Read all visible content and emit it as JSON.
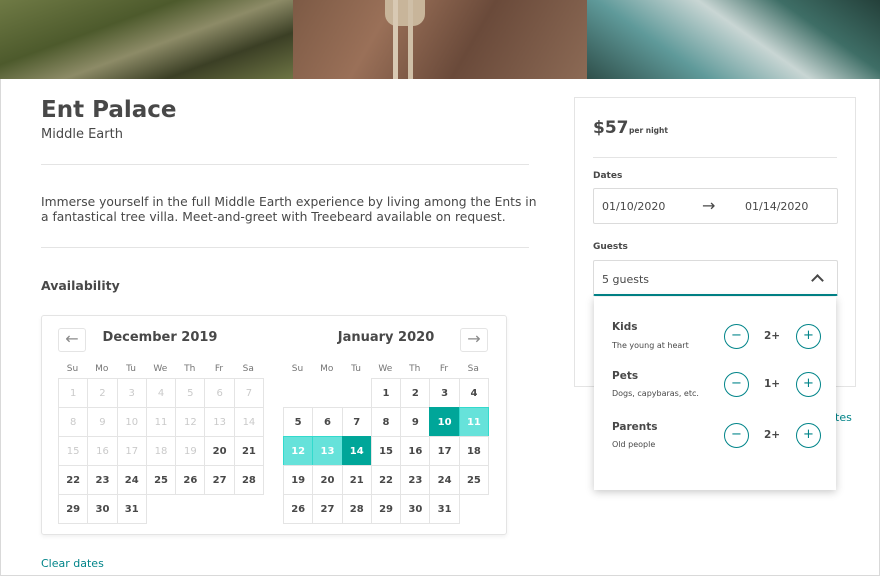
{
  "listing": {
    "title": "Ent Palace",
    "location": "Middle Earth",
    "description": "Immerse yourself in the full Middle Earth experience by living among the Ents in a fantastical tree villa. Meet-and-greet with Treebeard available on request.",
    "availability_label": "Availability"
  },
  "calendar": {
    "prev_icon": "arrow-left-icon",
    "next_icon": "arrow-right-icon",
    "weekdays": [
      "Su",
      "Mo",
      "Tu",
      "We",
      "Th",
      "Fr",
      "Sa"
    ],
    "months": [
      {
        "title": "December 2019",
        "offset": 0,
        "days": 31,
        "past_until": 19,
        "selected": [],
        "span": []
      },
      {
        "title": "January 2020",
        "offset": 3,
        "days": 31,
        "past_until": 0,
        "selected": [
          10,
          14
        ],
        "span": [
          11,
          12,
          13
        ]
      }
    ],
    "clear_label": "Clear dates"
  },
  "booking": {
    "price": "$57",
    "price_unit": "per night",
    "dates_label": "Dates",
    "start_date": "01/10/2020",
    "arrow": "→",
    "end_date": "01/14/2020",
    "guests_label": "Guests",
    "guests_value": "5 guests",
    "partial_link": "tes",
    "guest_types": [
      {
        "label": "Kids",
        "sub": "The young at heart",
        "count": "2+"
      },
      {
        "label": "Pets",
        "sub": "Dogs, capybaras, etc.",
        "count": "1+"
      },
      {
        "label": "Parents",
        "sub": "Old people",
        "count": "2+"
      }
    ],
    "minus": "−",
    "plus": "+"
  },
  "colors": {
    "accent": "#008489",
    "selected": "#00a699",
    "span": "#66e2da",
    "text": "#484848"
  }
}
